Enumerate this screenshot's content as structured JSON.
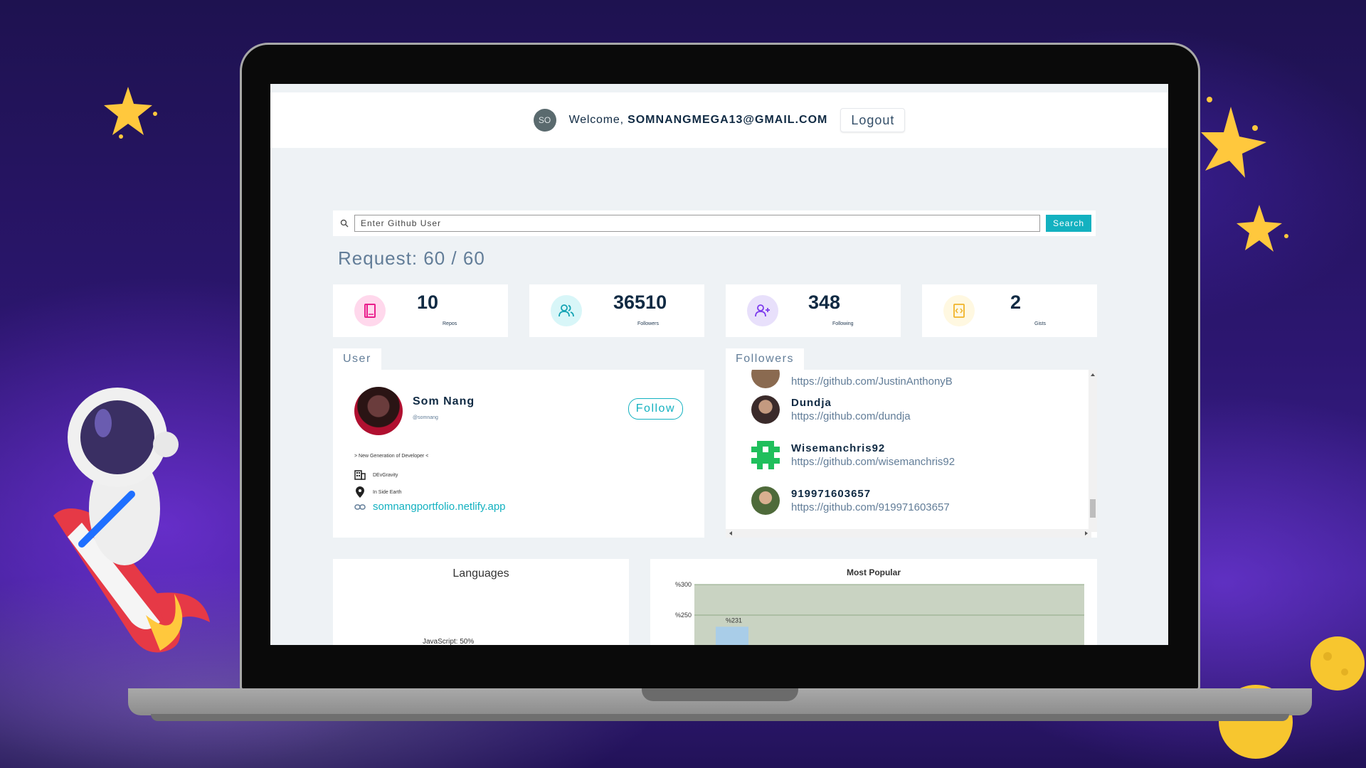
{
  "header": {
    "avatar_initials": "SO",
    "welcome_prefix": "Welcome, ",
    "user_email": "SOMNANGMEGA13@GMAIL.COM",
    "logout_label": "Logout"
  },
  "search": {
    "placeholder": "Enter Github User",
    "button_label": "Search"
  },
  "requests": {
    "text": "Request: 60 / 60"
  },
  "stats": [
    {
      "value": "10",
      "label": "Repos",
      "icon": "book-icon",
      "color": "#e91e8c",
      "bg": "#ffd8ec"
    },
    {
      "value": "36510",
      "label": "Followers",
      "icon": "users-icon",
      "color": "#14a3b3",
      "bg": "#d8f6f8"
    },
    {
      "value": "348",
      "label": "Following",
      "icon": "user-plus-icon",
      "color": "#7c3aed",
      "bg": "#e8e0fb"
    },
    {
      "value": "2",
      "label": "Gists",
      "icon": "code-icon",
      "color": "#f0b429",
      "bg": "#fff8e1"
    }
  ],
  "user_card": {
    "tab_label": "User",
    "name": "Som Nang",
    "handle": "@somnang",
    "follow_label": "Follow",
    "bio": "> New Generation of Developer <",
    "company": "DEvGravity",
    "location": "In Side Earth",
    "blog": "somnangportfolio.netlify.app"
  },
  "followers_card": {
    "tab_label": "Followers",
    "partial_url": "https://github.com/JustinAnthonyB",
    "items": [
      {
        "login": "Dundja",
        "url": "https://github.com/dundja"
      },
      {
        "login": "Wisemanchris92",
        "url": "https://github.com/wisemanchris92"
      },
      {
        "login": "919971603657",
        "url": "https://github.com/919971603657"
      }
    ]
  },
  "languages_card": {
    "title": "Languages",
    "label": "JavaScript: 50%"
  },
  "chart_data": {
    "type": "bar",
    "title": "Most Popular",
    "y_tick_labels": [
      "%300",
      "%250"
    ],
    "categories": [
      ""
    ],
    "values": [
      231
    ],
    "data_labels": [
      "%231"
    ],
    "ylim": [
      0,
      300
    ],
    "grid": true
  }
}
